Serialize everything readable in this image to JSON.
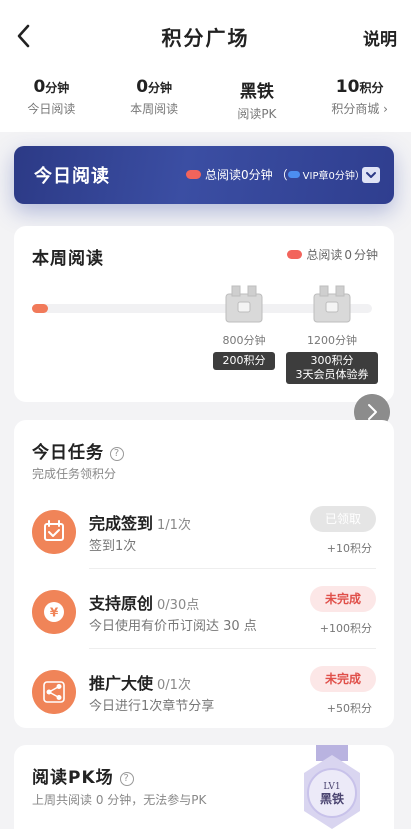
{
  "header": {
    "title": "积分广场",
    "help_label": "说明"
  },
  "stats": [
    {
      "value": "0",
      "unit": "分钟",
      "label": "今日阅读"
    },
    {
      "value": "0",
      "unit": "分钟",
      "label": "本周阅读"
    },
    {
      "value": "黑铁",
      "unit": "",
      "label": "阅读PK"
    },
    {
      "value": "10",
      "unit": "积分",
      "label": "积分商城 ›"
    }
  ],
  "today": {
    "title": "今日阅读",
    "total": "总阅读0分钟",
    "vip": "（",
    "vip_text": "VIP章0分钟）"
  },
  "week": {
    "title": "本周阅读",
    "total_label": "总阅读",
    "total_value": "0",
    "total_unit": "分钟",
    "progress_fraction": 0.0,
    "milestones": [
      {
        "minutes": "800分钟",
        "reward": "200积分",
        "reward2": ""
      },
      {
        "minutes": "1200分钟",
        "reward": "300积分",
        "reward2": "3天会员体验券"
      }
    ]
  },
  "tasks": {
    "title": "今日任务",
    "help_icon": "?",
    "subtitle": "完成任务领积分",
    "items": [
      {
        "name": "完成签到",
        "progress": "1/1次",
        "desc": "签到1次",
        "status": "已领取",
        "reward": "+10积分",
        "icon": "calendar-check-icon"
      },
      {
        "name": "支持原创",
        "progress": "0/30点",
        "desc": "今日使用有价币订阅达 30 点",
        "status": "未完成",
        "reward": "+100积分",
        "icon": "yen-icon"
      },
      {
        "name": "推广大使",
        "progress": "0/1次",
        "desc": "今日进行1次章节分享",
        "status": "未完成",
        "reward": "+50积分",
        "icon": "share-icon"
      }
    ]
  },
  "pk": {
    "title": "阅读PK场",
    "help_icon": "?",
    "desc": "上周共阅读 0 分钟，无法参与PK",
    "level": "LV1",
    "rank": "黑铁"
  },
  "colors": {
    "accent": "#f08458",
    "banner": "#2f3e8f",
    "todo": "#e0504a"
  }
}
